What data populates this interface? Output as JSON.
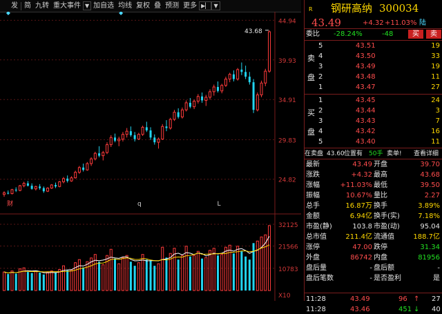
{
  "toolbar": {
    "items": [
      "发",
      "简",
      "九转",
      "重大事件",
      "加自选",
      "均线",
      "复权",
      "叠",
      "预测",
      "更多"
    ],
    "icons": [
      "dropdown-icon",
      "scroll-right-icon"
    ]
  },
  "chart": {
    "price_labels": [
      "44.94",
      "39.93",
      "34.91",
      "29.83",
      "24.82"
    ],
    "volume_labels": [
      "32125",
      "21566",
      "10783"
    ],
    "volume_unit": "X10",
    "peak_label": "43.68",
    "markers": [
      "财",
      "q",
      "L"
    ],
    "colors": {
      "up": "#ff3b3b",
      "down": "#22d4f0",
      "ma5": "#ffffff",
      "ma10": "#ffd800"
    }
  },
  "chart_data": {
    "type": "candlestick",
    "y_range": [
      22.0,
      45.5
    ],
    "volume_max": 32125,
    "candles": [
      [
        22.9,
        23.3,
        22.6,
        23.1,
        9000
      ],
      [
        23.1,
        23.4,
        22.9,
        23.0,
        8000
      ],
      [
        23.0,
        23.6,
        22.9,
        23.5,
        9500
      ],
      [
        23.5,
        23.8,
        23.2,
        23.4,
        8200
      ],
      [
        23.4,
        24.1,
        23.3,
        24.0,
        10500
      ],
      [
        24.0,
        24.5,
        23.8,
        24.3,
        11000
      ],
      [
        24.3,
        24.6,
        23.9,
        24.0,
        9000
      ],
      [
        24.0,
        24.3,
        23.5,
        23.6,
        8500
      ],
      [
        23.6,
        24.0,
        23.4,
        23.9,
        9200
      ],
      [
        23.9,
        24.2,
        23.5,
        23.7,
        8700
      ],
      [
        23.7,
        23.9,
        23.1,
        23.3,
        7800
      ],
      [
        23.3,
        23.8,
        23.2,
        23.7,
        8800
      ],
      [
        23.7,
        24.2,
        23.6,
        24.1,
        9500
      ],
      [
        24.1,
        24.4,
        23.7,
        23.9,
        8600
      ],
      [
        23.9,
        24.6,
        23.8,
        24.5,
        10200
      ],
      [
        24.5,
        25.1,
        24.3,
        24.9,
        12000
      ],
      [
        24.9,
        25.3,
        24.4,
        24.6,
        9800
      ],
      [
        24.6,
        25.2,
        24.5,
        25.0,
        10000
      ],
      [
        25.0,
        25.9,
        24.9,
        25.7,
        13500
      ],
      [
        25.7,
        26.5,
        25.5,
        26.3,
        15000
      ],
      [
        26.3,
        26.8,
        25.8,
        26.0,
        11200
      ],
      [
        26.0,
        27.0,
        25.9,
        26.8,
        14000
      ],
      [
        26.8,
        27.6,
        26.5,
        27.4,
        15800
      ],
      [
        27.4,
        28.3,
        27.2,
        28.1,
        17500
      ],
      [
        28.1,
        29.0,
        27.6,
        27.8,
        14000
      ],
      [
        27.8,
        28.4,
        27.2,
        28.2,
        12500
      ],
      [
        28.2,
        29.5,
        28.0,
        29.2,
        17000
      ],
      [
        29.2,
        30.4,
        28.9,
        30.1,
        20000
      ],
      [
        30.1,
        30.6,
        29.5,
        29.7,
        15500
      ],
      [
        29.7,
        30.2,
        29.0,
        29.9,
        13000
      ],
      [
        29.9,
        30.8,
        29.6,
        30.5,
        16000
      ],
      [
        30.5,
        31.3,
        30.1,
        30.9,
        17000
      ],
      [
        30.9,
        31.5,
        30.2,
        30.4,
        14000
      ],
      [
        30.4,
        30.8,
        29.6,
        29.9,
        12000
      ],
      [
        29.9,
        30.7,
        29.8,
        30.5,
        13500
      ],
      [
        30.5,
        31.6,
        30.3,
        31.4,
        17500
      ],
      [
        31.4,
        32.1,
        30.8,
        31.0,
        15000
      ],
      [
        31.0,
        31.4,
        29.8,
        30.1,
        14500
      ],
      [
        30.1,
        30.5,
        29.2,
        29.5,
        12000
      ],
      [
        29.5,
        30.1,
        28.7,
        29.9,
        13000
      ],
      [
        29.9,
        31.8,
        29.8,
        31.5,
        21000
      ],
      [
        31.5,
        32.3,
        30.9,
        31.3,
        16000
      ],
      [
        31.3,
        32.6,
        31.1,
        32.4,
        18000
      ],
      [
        32.4,
        33.6,
        32.2,
        33.3,
        20500
      ],
      [
        33.3,
        33.8,
        32.5,
        32.7,
        15000
      ],
      [
        32.7,
        33.9,
        32.5,
        33.6,
        17000
      ],
      [
        33.6,
        34.8,
        33.4,
        34.5,
        21500
      ],
      [
        34.5,
        35.1,
        33.8,
        34.0,
        16500
      ],
      [
        34.0,
        34.9,
        33.7,
        34.7,
        17000
      ],
      [
        34.7,
        35.6,
        34.4,
        35.3,
        19000
      ],
      [
        35.3,
        35.8,
        34.5,
        34.8,
        15500
      ],
      [
        34.8,
        35.5,
        34.1,
        35.2,
        16000
      ],
      [
        35.2,
        36.2,
        34.9,
        35.9,
        19500
      ],
      [
        35.9,
        36.8,
        35.4,
        36.5,
        20500
      ],
      [
        36.5,
        37.2,
        35.8,
        36.0,
        17000
      ],
      [
        36.0,
        36.9,
        35.7,
        36.7,
        17500
      ],
      [
        36.7,
        37.8,
        36.5,
        37.5,
        21000
      ],
      [
        37.5,
        38.3,
        37.1,
        38.1,
        22000
      ],
      [
        38.1,
        38.6,
        37.2,
        37.5,
        18000
      ],
      [
        37.5,
        38.9,
        37.3,
        38.7,
        21500
      ],
      [
        38.7,
        39.6,
        38.0,
        38.4,
        19000
      ],
      [
        38.4,
        39.2,
        37.5,
        37.8,
        16500
      ],
      [
        37.8,
        38.4,
        36.8,
        37.1,
        15000
      ],
      [
        37.1,
        37.5,
        33.2,
        33.6,
        23000
      ],
      [
        33.6,
        35.8,
        33.4,
        35.5,
        24000
      ],
      [
        35.5,
        37.3,
        35.2,
        37.0,
        26000
      ],
      [
        37.0,
        38.8,
        36.6,
        38.5,
        27000
      ],
      [
        38.5,
        43.68,
        38.3,
        43.49,
        31500
      ]
    ]
  },
  "quote": {
    "rank_badge": "R",
    "name": "钢研高纳",
    "code": "300034",
    "price": "43.49",
    "change": "+4.32",
    "change_pct": "+11.03%",
    "badge": "陆",
    "weibi_label": "委比",
    "weibi_pct": "-28.24%",
    "weibi_diff": "-48",
    "sell_btn": "买",
    "buy_btn": "卖",
    "sell_side_label": [
      "卖",
      "盘"
    ],
    "buy_side_label": [
      "买",
      "盘"
    ],
    "asks": [
      {
        "level": "5",
        "price": "43.51",
        "vol": "19"
      },
      {
        "level": "4",
        "price": "43.50",
        "vol": "33"
      },
      {
        "level": "3",
        "price": "43.49",
        "vol": "19"
      },
      {
        "level": "2",
        "price": "43.48",
        "vol": "11"
      },
      {
        "level": "1",
        "price": "43.47",
        "vol": "27"
      }
    ],
    "bids": [
      {
        "level": "1",
        "price": "43.45",
        "vol": "24"
      },
      {
        "level": "2",
        "price": "43.44",
        "vol": "3"
      },
      {
        "level": "3",
        "price": "43.43",
        "vol": "7"
      },
      {
        "level": "4",
        "price": "43.42",
        "vol": "16"
      },
      {
        "level": "5",
        "price": "43.40",
        "vol": "11"
      }
    ],
    "notice": "在卖盘43.60位置有 50手 卖单!",
    "notice_parts": {
      "a": "在卖盘",
      "b": "43.60",
      "c": "位置有",
      "d": "50手",
      "e": "卖单!"
    },
    "detail_link": "查看详细",
    "stats": [
      {
        "l1": "最新",
        "v1": "43.49",
        "c1": "red",
        "l2": "开盘",
        "v2": "39.70",
        "c2": "red"
      },
      {
        "l1": "涨跌",
        "v1": "+4.32",
        "c1": "red",
        "l2": "最高",
        "v2": "43.68",
        "c2": "red"
      },
      {
        "l1": "涨幅",
        "v1": "+11.03%",
        "c1": "red",
        "l2": "最低",
        "v2": "39.50",
        "c2": "red"
      },
      {
        "l1": "振幅",
        "v1": "10.67%",
        "c1": "red",
        "l2": "量比",
        "v2": "2.27",
        "c2": "red"
      },
      {
        "l1": "总手",
        "v1": "16.87万",
        "c1": "yellow",
        "l2": "换手",
        "v2": "3.89%",
        "c2": "yellow"
      },
      {
        "l1": "金额",
        "v1": "6.94亿",
        "c1": "yellow",
        "l2": "换手(实)",
        "v2": "7.18%",
        "c2": "yellow"
      },
      {
        "l1": "市盈(静)",
        "v1": "103.8",
        "c1": "white",
        "l2": "市盈(动)",
        "v2": "95.04",
        "c2": "white"
      },
      {
        "l1": "总市值",
        "v1": "211.4亿",
        "c1": "yellow",
        "l2": "流通值",
        "v2": "188.7亿",
        "c2": "yellow"
      },
      {
        "l1": "涨停",
        "v1": "47.00",
        "c1": "red",
        "l2": "跌停",
        "v2": "31.34",
        "c2": "green"
      },
      {
        "l1": "外盘",
        "v1": "86742",
        "c1": "red",
        "l2": "内盘",
        "v2": "81956",
        "c2": "green"
      },
      {
        "l1": "盘后量",
        "v1": "-",
        "c1": "white",
        "l2": "盘后额",
        "v2": "-",
        "c2": "white"
      },
      {
        "l1": "盘后笔数",
        "v1": "-",
        "c1": "white",
        "l2": "是否盈利",
        "v2": "是",
        "c2": "white"
      }
    ],
    "ticks": [
      {
        "time": "11:28",
        "price": "43.49",
        "price_c": "red",
        "vol": "96",
        "arrow": "↑",
        "arrow_c": "red",
        "count": "27"
      },
      {
        "time": "11:28",
        "price": "43.46",
        "price_c": "red",
        "vol": "451",
        "arrow": "↓",
        "arrow_c": "green",
        "count": "40"
      }
    ]
  }
}
